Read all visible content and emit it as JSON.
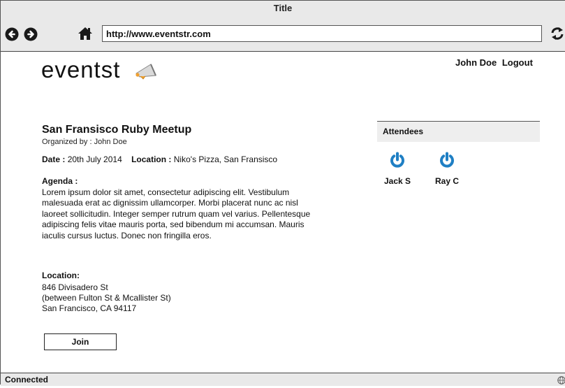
{
  "window": {
    "title": "Title"
  },
  "browser": {
    "url": "http://www.eventstr.com"
  },
  "header": {
    "logo_text": "eventst",
    "user_name": "John Doe",
    "logout_label": "Logout"
  },
  "event": {
    "title": "San Fransisco Ruby Meetup",
    "organizer": "Organized by : John Doe",
    "date_label": "Date :",
    "date_value": "20th July 2014",
    "location_label": "Location :",
    "location_value": "Niko's Pizza, San Fransisco",
    "agenda_heading": "Agenda :",
    "agenda_text": "Lorem ipsum dolor sit amet, consectetur adipiscing elit. Vestibulum malesuada erat ac dignissim ullamcorper. Morbi placerat nunc ac nisl laoreet sollicitudin. Integer semper rutrum quam vel varius. Pellentesque adipiscing felis vitae mauris porta, sed bibendum mi accumsan. Mauris iaculis cursus luctus. Donec non fringilla eros.",
    "address_heading": "Location:",
    "address_line1": "846 Divisadero St",
    "address_line2": "(between Fulton St & Mcallister St)",
    "address_line3": "San Francisco, CA 94117",
    "join_label": "Join"
  },
  "attendees": {
    "heading": "Attendees",
    "people": [
      {
        "name": "Jack S",
        "icon": "power-icon"
      },
      {
        "name": "Ray C",
        "icon": "power-icon"
      }
    ]
  },
  "status": {
    "text": "Connected"
  },
  "colors": {
    "accent": "#1f7fc4",
    "chrome": "#e9e9e9",
    "panel": "#eeeeee"
  }
}
